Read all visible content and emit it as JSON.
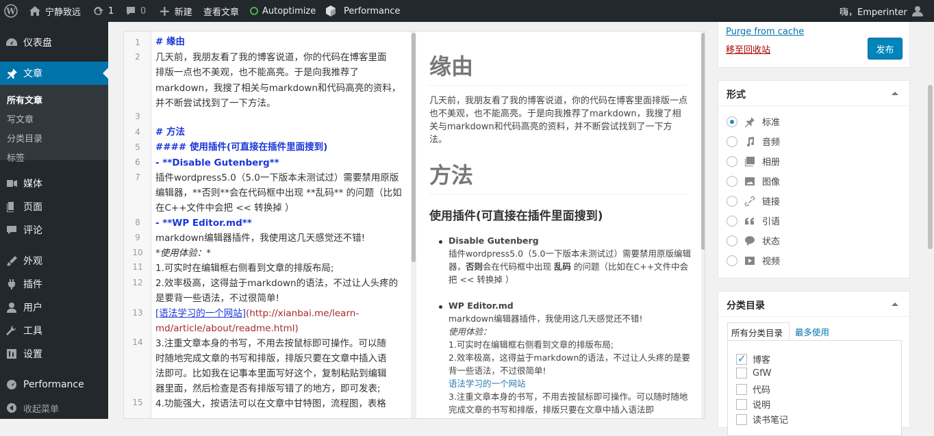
{
  "admin_bar": {
    "site_name": "宁静致远",
    "updates_count": "1",
    "comments_count": "0",
    "new_label": "新建",
    "view_post_label": "查看文章",
    "autoptimize_label": "Autoptimize",
    "performance_label": "Performance",
    "greeting": "嗨，Emperinter",
    "status_color": "#46b450"
  },
  "sidebar": {
    "dashboard": "仪表盘",
    "posts": "文章",
    "sub": {
      "all": "所有文章",
      "write": "写文章",
      "categories": "分类目录",
      "tags": "标签"
    },
    "media": "媒体",
    "pages": "页面",
    "comments": "评论",
    "appearance": "外观",
    "plugins": "插件",
    "users": "用户",
    "tools": "工具",
    "settings": "设置",
    "performance": "Performance",
    "collapse": "收起菜单"
  },
  "editor": {
    "line_numbers": [
      "1",
      "2",
      "3",
      "4",
      "5",
      "6",
      "7",
      "8",
      "9",
      "10",
      "11",
      "12",
      "13",
      "14",
      "15"
    ],
    "code_lines": [
      "# 缘由",
      "几天前，我朋友看了我的博客说道，你的代码在博客里面",
      "排版一点也不美观，也不能高亮。于是向我推荐了",
      "markdown，我搜了相关与markdown和代码高亮的资料，",
      "并不断尝试找到了一下方法。",
      "# 方法",
      "#### 使用插件(可直接在插件里面搜到)",
      "- **Disable Gutenberg**",
      "插件wordpress5.0（5.0一下版本未测试过）需要禁用原版",
      "编辑器，**否则**会在代码框中出现 **乱码** 的问题（比如",
      "在C++文件中会把 << 转换掉 ）",
      "- **WP Editor.md**",
      "markdown编辑器插件，我使用这几天感觉还不错!",
      "*使用体验：*",
      "1.可实时在编辑框右侧看到文章的排版布局;",
      "2.效率极高，这得益于markdown的语法，不过让人头疼的",
      "是要背一些语法，不过很简单!",
      "[语法学习的一个网站]",
      "(http://xianbai.me/learn-",
      "md/article/about/readme.html)",
      "3.注重文章本身的书写，不用去按鼠标即可操作。可以随",
      "时随地完成文章的书写和排版，排版只要在文章中插入语",
      "法即可。比如我在记事本里面写好这个，复制粘贴到编辑",
      "器里面，然后检查是否有排版写错了的地方，即可发表;",
      "4.功能强大，按语法可以在文章中甘特图，流程图，表格"
    ]
  },
  "preview": {
    "h1_reason": "缘由",
    "p_reason": "几天前，我朋友看了我的博客说道，你的代码在博客里面排版一点也不美观，也不能高亮。于是向我推荐了markdown，我搜了相关与markdown和代码高亮的资料，并不断尝试找到了一下方法。",
    "h1_method": "方法",
    "h3_plugins": "使用插件(可直接在插件里面搜到)",
    "li1_title": "Disable Gutenberg",
    "li1_text_a": "插件wordpress5.0（5.0一下版本未测试过）需要禁用原版编辑器，",
    "li1_bold1": "否则",
    "li1_text_b": "会在代码框中出现 ",
    "li1_bold2": "乱码",
    "li1_text_c": " 的问题（比如在C++文件中会把 << 转换掉 ）",
    "li2_title": "WP Editor.md",
    "li2_line1": "markdown编辑器插件，我使用这几天感觉还不错!",
    "li2_line2": "使用体验：",
    "li2_line3": "1.可实时在编辑框右侧看到文章的排版布局;",
    "li2_line4": "2.效率极高，这得益于markdown的语法，不过让人头疼的是要背一些语法，不过很简单!",
    "li2_link": "语法学习的一个网站",
    "li2_line5": "3.注重文章本身的书写，不用去按鼠标即可操作。可以随时随地完成文章的书写和排版，排版只要在文章中插入语法即"
  },
  "publish": {
    "purge_label": "Purge from cache",
    "trash_label": "移至回收站",
    "publish_button": "发布"
  },
  "format_box": {
    "title": "形式",
    "options": [
      "标准",
      "音频",
      "相册",
      "图像",
      "链接",
      "引语",
      "状态",
      "视频"
    ],
    "selected": "标准"
  },
  "category_box": {
    "title": "分类目录",
    "tab_all": "所有分类目录",
    "tab_popular": "最多使用",
    "items": [
      {
        "name": "博客",
        "checked": true
      },
      {
        "name": "GfW",
        "checked": false
      },
      {
        "name": "代码",
        "checked": false
      },
      {
        "name": "说明",
        "checked": false
      },
      {
        "name": "读书笔记",
        "checked": false
      }
    ]
  }
}
